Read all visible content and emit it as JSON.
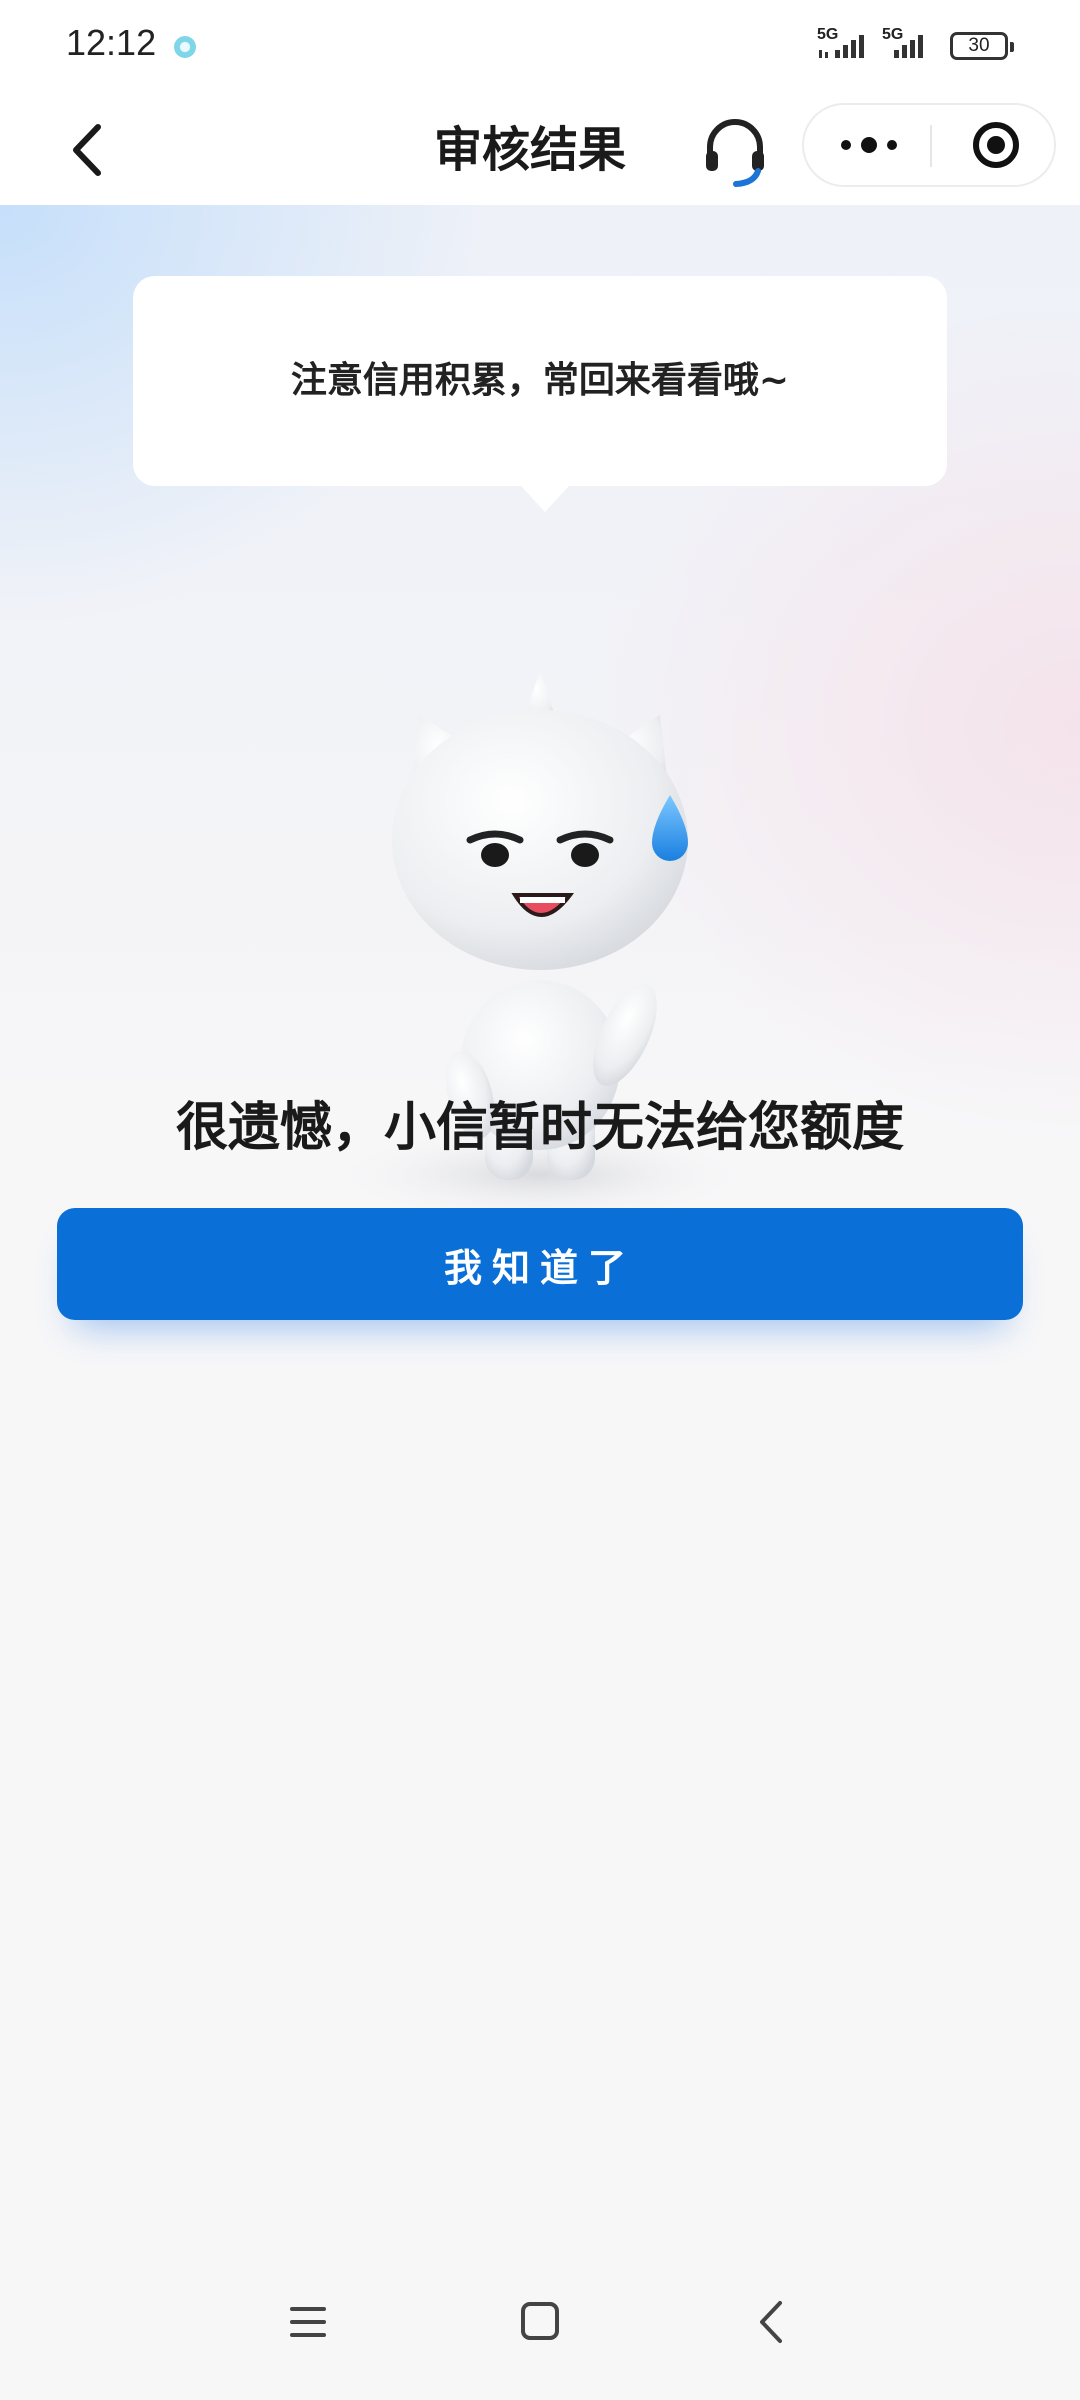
{
  "status_bar": {
    "time": "12:12",
    "network_1": "5G",
    "network_2": "5G",
    "battery": "30"
  },
  "navbar": {
    "title": "审核结果",
    "back_icon": "chevron-left-icon",
    "service_icon": "headset-icon",
    "more_icon": "more-dots-icon",
    "close_icon": "target-close-icon"
  },
  "main": {
    "bubble_text": "注意信用积累，常回来看看哦~",
    "result_title": "很遗憾，小信暂时无法给您额度",
    "button_label": "我知道了"
  },
  "colors": {
    "primary": "#0a6fd6",
    "background": "#f7f7f8",
    "text": "#1a1a1a"
  },
  "system_nav": {
    "menu_icon": "menu-icon",
    "home_icon": "home-square-icon",
    "back_icon": "back-chevron-icon"
  }
}
